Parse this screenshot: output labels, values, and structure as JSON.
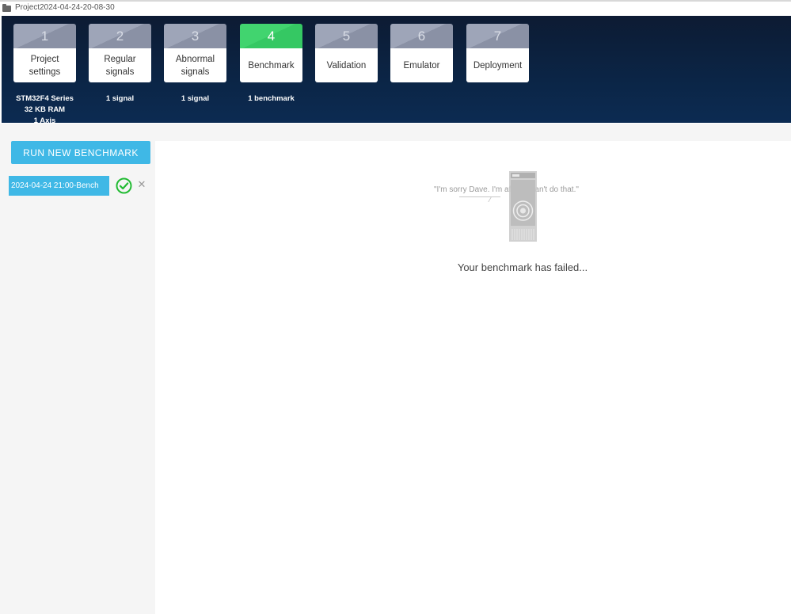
{
  "window": {
    "title": "Project2024-04-24-20-08-30",
    "icon": "folder-icon"
  },
  "steps": [
    {
      "number": "1",
      "label": "Project\nsettings",
      "sub": "STM32F4 Series\n32 KB RAM\n1 Axis"
    },
    {
      "number": "2",
      "label": "Regular\nsignals",
      "sub": "1 signal"
    },
    {
      "number": "3",
      "label": "Abnormal\nsignals",
      "sub": "1 signal"
    },
    {
      "number": "4",
      "label": "Benchmark",
      "sub": "1 benchmark"
    },
    {
      "number": "5",
      "label": "Validation",
      "sub": ""
    },
    {
      "number": "6",
      "label": "Emulator",
      "sub": ""
    },
    {
      "number": "7",
      "label": "Deployment",
      "sub": ""
    }
  ],
  "active_step": 4,
  "sidebar": {
    "run_button_label": "RUN NEW BENCHMARK",
    "benchmarks": [
      {
        "name": "2024-04-24 21:00-Bench",
        "status_icon": "check-circle-icon",
        "remove_icon": "close-icon"
      }
    ]
  },
  "main": {
    "quote": "\"I'm sorry Dave. I'm afraid I can't do that.\"",
    "illustration_icon": "hal-9000-icon",
    "message": "Your benchmark has failed..."
  },
  "colors": {
    "header_bg": "#0b2546",
    "step_inactive": "#9ea5b8",
    "step_active": "#41d46f",
    "accent": "#3fb8e6",
    "success": "#22bb33"
  }
}
